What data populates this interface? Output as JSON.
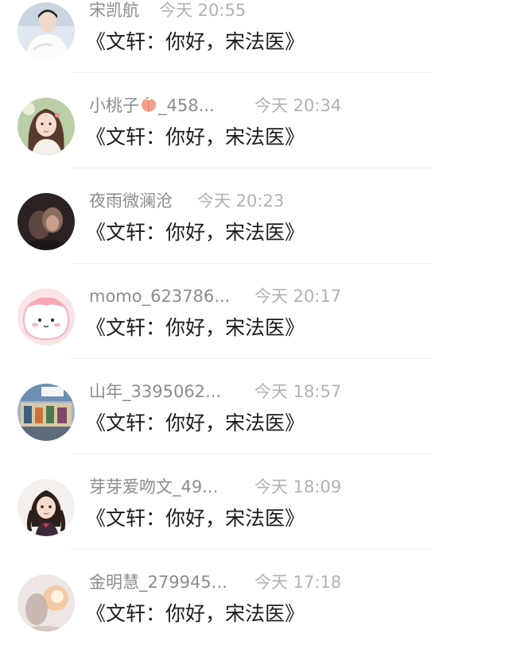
{
  "messages": [
    {
      "name": "宋凯航",
      "time": "今天 20:55",
      "text": "《文轩：你好，宋法医》",
      "avatar": "avatar-boy-white"
    },
    {
      "name_prefix": "小桃子",
      "name_icon": "peach-emoji-icon",
      "name_suffix": "_458...",
      "time": "今天 20:34",
      "text": "《文轩：你好，宋法医》",
      "avatar": "avatar-girl-illustration"
    },
    {
      "name": "夜雨微澜沧",
      "time": "今天 20:23",
      "text": "《文轩：你好，宋法医》",
      "avatar": "avatar-dark-couple"
    },
    {
      "name": "momo_623786...",
      "time": "今天 20:17",
      "text": "《文轩：你好，宋法医》",
      "avatar": "avatar-pink-blob"
    },
    {
      "name": "山年_3395062...",
      "time": "今天 18:57",
      "text": "《文轩：你好，宋法医》",
      "avatar": "avatar-store-photo"
    },
    {
      "name": "芽芽爱吻文_49...",
      "time": "今天 18:09",
      "text": "《文轩：你好，宋法医》",
      "avatar": "avatar-braids-girl"
    },
    {
      "name": "金明慧_279945...",
      "time": "今天 17:18",
      "text": "《文轩：你好，宋法医》",
      "avatar": "avatar-blurred-light"
    }
  ],
  "colors": {
    "name": "#8c8c8c",
    "time": "#b2b2b2",
    "message": "#1c1c1c",
    "divider": "#efefef",
    "background": "#ffffff"
  }
}
